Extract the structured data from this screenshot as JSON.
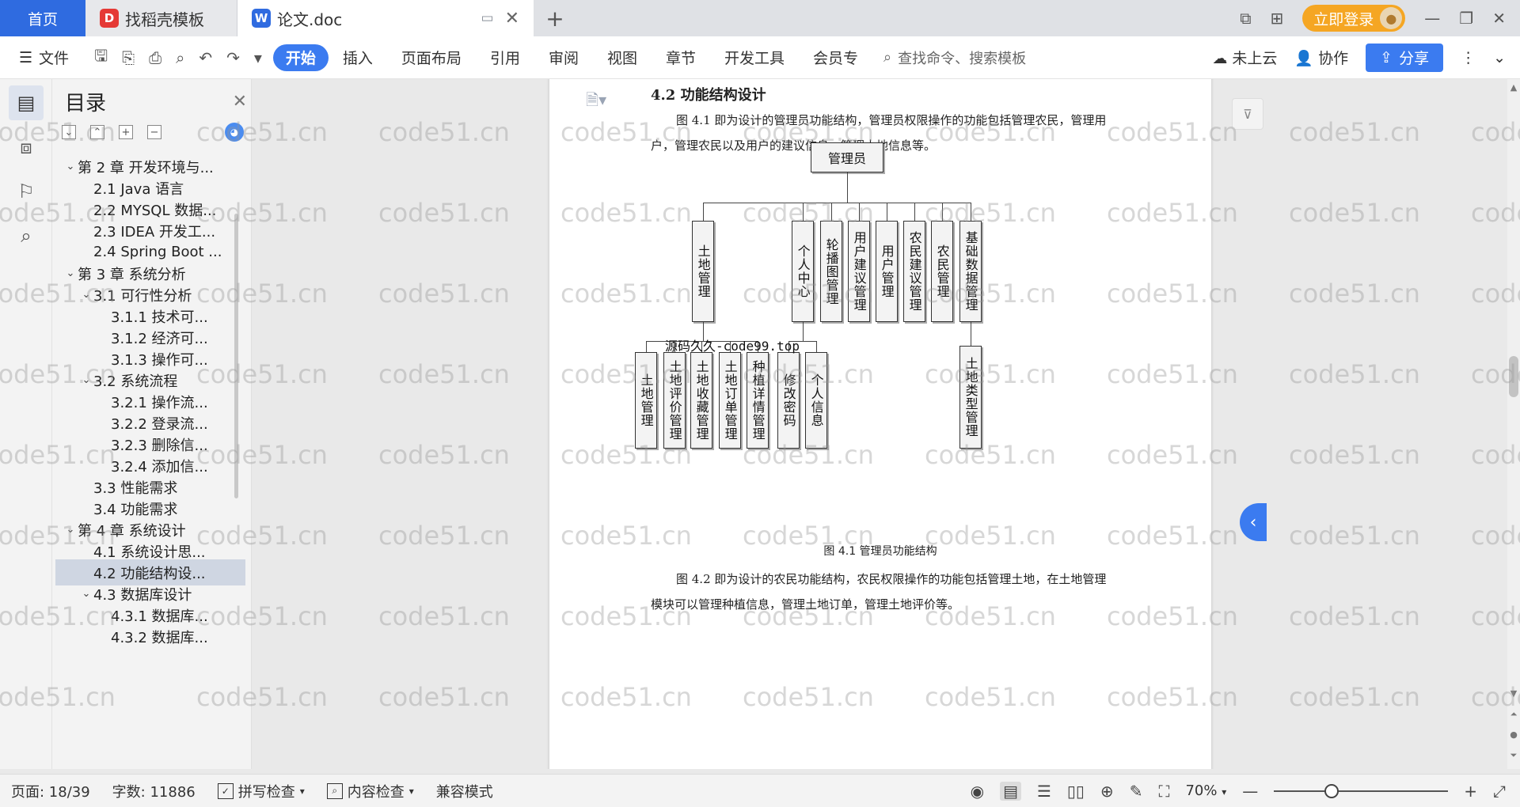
{
  "tabs": {
    "home": "首页",
    "templates": "找稻壳模板",
    "doc": "论文.doc",
    "template_icon_letter": "D",
    "doc_icon_letter": "W"
  },
  "titlebar": {
    "login": "立即登录"
  },
  "menu": {
    "file": "文件",
    "tabs": [
      "开始",
      "插入",
      "页面布局",
      "引用",
      "审阅",
      "视图",
      "章节",
      "开发工具",
      "会员专"
    ],
    "search_placeholder": "查找命令、搜索模板",
    "cloud": "未上云",
    "collab": "协作",
    "share": "分享"
  },
  "toc": {
    "title": "目录",
    "items": [
      {
        "label": "第 2 章  开发环境与...",
        "level": 1,
        "expanded": true
      },
      {
        "label": "2.1 Java 语言",
        "level": 2
      },
      {
        "label": "2.2 MYSQL 数据...",
        "level": 2
      },
      {
        "label": "2.3 IDEA 开发工...",
        "level": 2
      },
      {
        "label": "2.4 Spring Boot ...",
        "level": 2
      },
      {
        "label": "第 3 章  系统分析",
        "level": 1,
        "expanded": true
      },
      {
        "label": "3.1  可行性分析",
        "level": 2,
        "expanded": true
      },
      {
        "label": "3.1.1  技术可...",
        "level": 3
      },
      {
        "label": "3.1.2  经济可...",
        "level": 3
      },
      {
        "label": "3.1.3  操作可...",
        "level": 3
      },
      {
        "label": "3.2  系统流程",
        "level": 2,
        "expanded": true
      },
      {
        "label": "3.2.1  操作流...",
        "level": 3
      },
      {
        "label": "3.2.2  登录流...",
        "level": 3
      },
      {
        "label": "3.2.3  删除信...",
        "level": 3
      },
      {
        "label": "3.2.4  添加信...",
        "level": 3
      },
      {
        "label": "3.3  性能需求",
        "level": 2
      },
      {
        "label": "3.4  功能需求",
        "level": 2
      },
      {
        "label": "第 4 章  系统设计",
        "level": 1,
        "expanded": true
      },
      {
        "label": "4.1  系统设计思...",
        "level": 2
      },
      {
        "label": "4.2  功能结构设...",
        "level": 2,
        "selected": true
      },
      {
        "label": "4.3  数据库设计",
        "level": 2,
        "expanded": true
      },
      {
        "label": "4.3.1  数据库...",
        "level": 3
      },
      {
        "label": "4.3.2  数据库...",
        "level": 3
      }
    ]
  },
  "doc": {
    "heading": "4.2  功能结构设计",
    "para1": "图 4.1 即为设计的管理员功能结构，管理员权限操作的功能包括管理农民，管理用户，管理农民以及用户的建议信息，管理土地信息等。",
    "caption": "图 4.1  管理员功能结构",
    "para2": "图 4.2 即为设计的农民功能结构，农民权限操作的功能包括管理土地，在土地管理模块可以管理种植信息，管理土地订单，管理土地评价等。",
    "overlay": "源码久久-code99.top"
  },
  "chart": {
    "root": "管理员",
    "level1": [
      "土地管理",
      "个人中心",
      "轮播图管理",
      "用户建议管理",
      "用户管理",
      "农民建议管理",
      "农民管理",
      "基础数据管理"
    ],
    "land_children": [
      "土地管理",
      "土地评价管理",
      "土地收藏管理",
      "土地订单管理",
      "种植详情管理"
    ],
    "personal_children": [
      "修改密码",
      "个人信息"
    ],
    "base_children": [
      "土地类型管理"
    ]
  },
  "watermark": "code51.cn",
  "status": {
    "page": "页面: 18/39",
    "words": "字数: 11886",
    "spell": "拼写检查",
    "content": "内容检查",
    "compat": "兼容模式",
    "zoom": "70%"
  }
}
